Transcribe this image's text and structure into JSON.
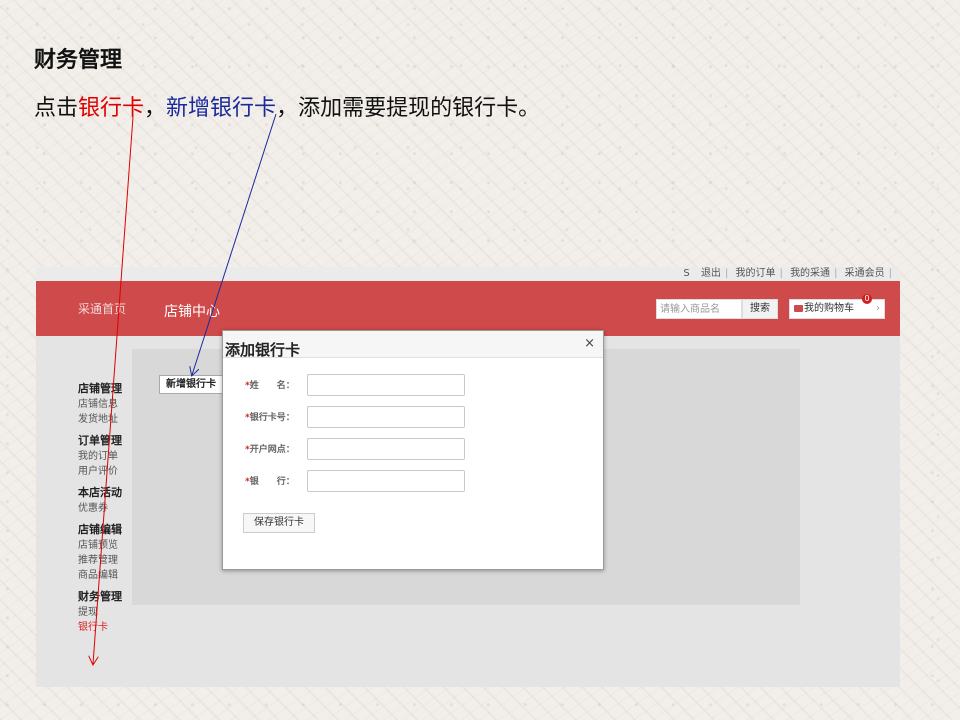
{
  "slide": {
    "title": "财务管理",
    "instruction": {
      "prefix": "点击",
      "highlight_red": "银行卡",
      "sep": "，",
      "highlight_blue": "新增银行卡",
      "suffix": "，添加需要提现的银行卡。"
    },
    "colors": {
      "red": "#e00000",
      "blue": "#1a2a9a"
    }
  },
  "topbar": {
    "links": [
      "S",
      "退出",
      "我的订单",
      "我的采通",
      "采通会员"
    ]
  },
  "header": {
    "nav_home": "采通首页",
    "nav_store": "店铺中心",
    "search_placeholder": "请输入商品名",
    "search_button": "搜索",
    "cart_label": "我的购物车",
    "cart_count": "0",
    "cart_icon": "cart-icon",
    "brand_color": "#cf4a4a"
  },
  "content": {
    "add_card_button": "新增银行卡"
  },
  "sidebar": {
    "groups": [
      {
        "title": "店铺管理",
        "items": [
          "店铺信息",
          "发货地址"
        ]
      },
      {
        "title": "订单管理",
        "items": [
          "我的订单",
          "用户评价"
        ]
      },
      {
        "title": "本店活动",
        "items": [
          "优惠券"
        ]
      },
      {
        "title": "店铺编辑",
        "items": [
          "店铺预览",
          "推荐管理",
          "商品编辑"
        ]
      },
      {
        "title": "财务管理",
        "items": [
          "提现",
          "银行卡"
        ]
      }
    ]
  },
  "modal": {
    "title": "添加银行卡",
    "close": "×",
    "fields": [
      {
        "star": "*",
        "label": "姓　　名：",
        "value": ""
      },
      {
        "star": "*",
        "label": "银行卡号：",
        "value": ""
      },
      {
        "star": "*",
        "label": "开户网点：",
        "value": ""
      },
      {
        "star": "*",
        "label": "银　　行：",
        "value": ""
      }
    ],
    "save_button": "保存银行卡"
  }
}
